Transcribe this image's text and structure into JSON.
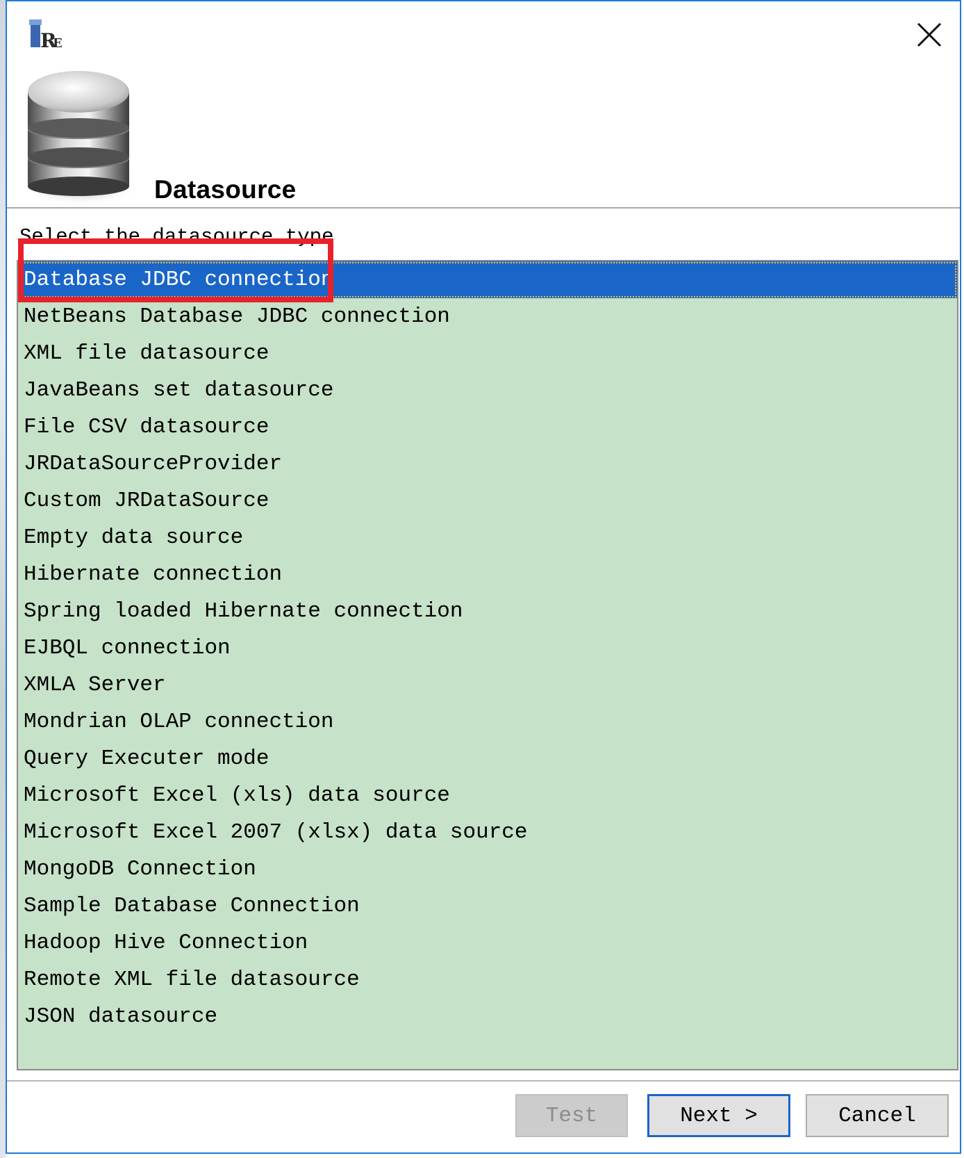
{
  "dialog": {
    "title": "Datasource",
    "prompt": "Select the datasource type"
  },
  "datasource_types": [
    {
      "label": "Database JDBC connection",
      "selected": true
    },
    {
      "label": "NetBeans Database JDBC connection"
    },
    {
      "label": "XML file datasource"
    },
    {
      "label": "JavaBeans set datasource"
    },
    {
      "label": "File CSV datasource"
    },
    {
      "label": "JRDataSourceProvider"
    },
    {
      "label": "Custom JRDataSource"
    },
    {
      "label": "Empty data source"
    },
    {
      "label": "Hibernate connection"
    },
    {
      "label": "Spring loaded Hibernate connection"
    },
    {
      "label": "EJBQL connection"
    },
    {
      "label": "XMLA Server"
    },
    {
      "label": "Mondrian OLAP connection"
    },
    {
      "label": "Query Executer mode"
    },
    {
      "label": "Microsoft Excel (xls) data source"
    },
    {
      "label": "Microsoft Excel 2007 (xlsx) data source"
    },
    {
      "label": "MongoDB Connection"
    },
    {
      "label": "Sample Database Connection"
    },
    {
      "label": "Hadoop Hive Connection"
    },
    {
      "label": "Remote XML file datasource"
    },
    {
      "label": "JSON datasource"
    }
  ],
  "buttons": {
    "test": "Test",
    "next": "Next >",
    "cancel": "Cancel"
  },
  "colors": {
    "list_background": "#c6e2c8",
    "selection": "#1a66c8",
    "annotation": "#e8222b",
    "window_border": "#1e7bd6"
  },
  "icons": {
    "app": "ireport-app-icon",
    "close": "close-icon",
    "datasource": "database-icon"
  }
}
